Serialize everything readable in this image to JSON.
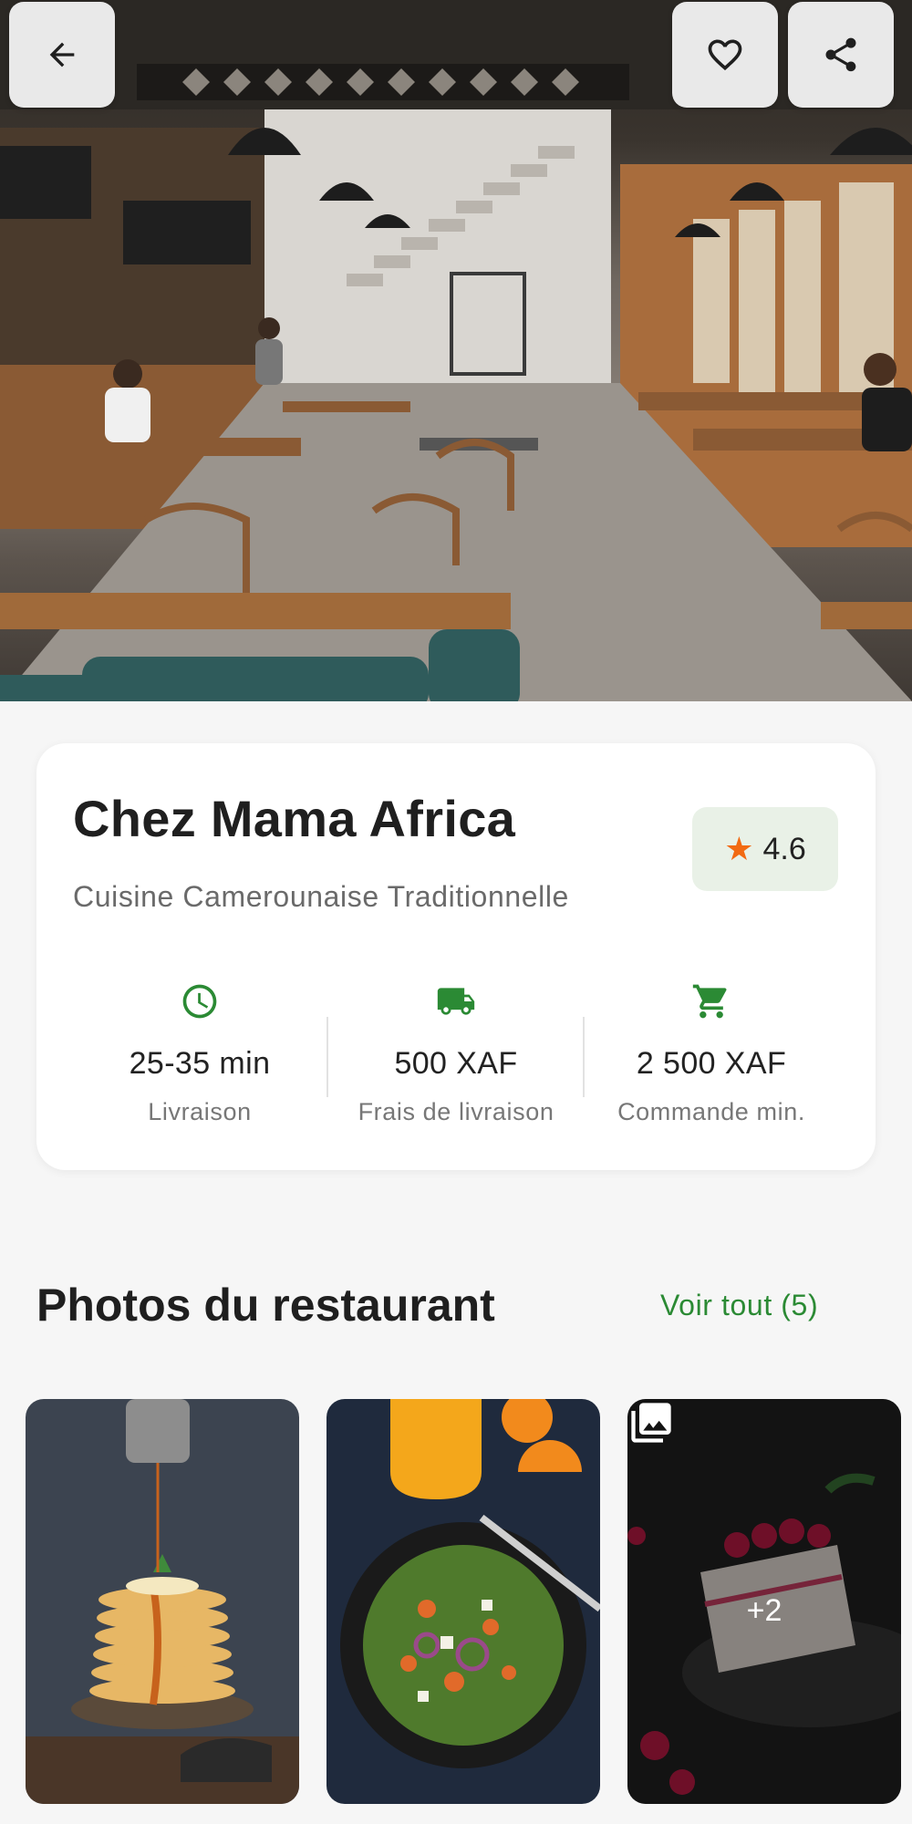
{
  "restaurant": {
    "name": "Chez Mama Africa",
    "cuisine": "Cuisine Camerounaise Traditionnelle",
    "rating": "4.6"
  },
  "stats": [
    {
      "icon": "clock-icon",
      "value": "25-35 min",
      "label": "Livraison"
    },
    {
      "icon": "delivery-truck-icon",
      "value": "500 XAF",
      "label": "Frais de livraison"
    },
    {
      "icon": "shopping-cart-icon",
      "value": "2 500 XAF",
      "label": "Commande min."
    }
  ],
  "photos": {
    "title": "Photos du restaurant",
    "see_all": "Voir tout (5)",
    "more_count": "+2"
  },
  "colors": {
    "accent_green": "#2b8a34",
    "star_orange": "#f26a12",
    "rating_bg": "#e9f1e7"
  }
}
